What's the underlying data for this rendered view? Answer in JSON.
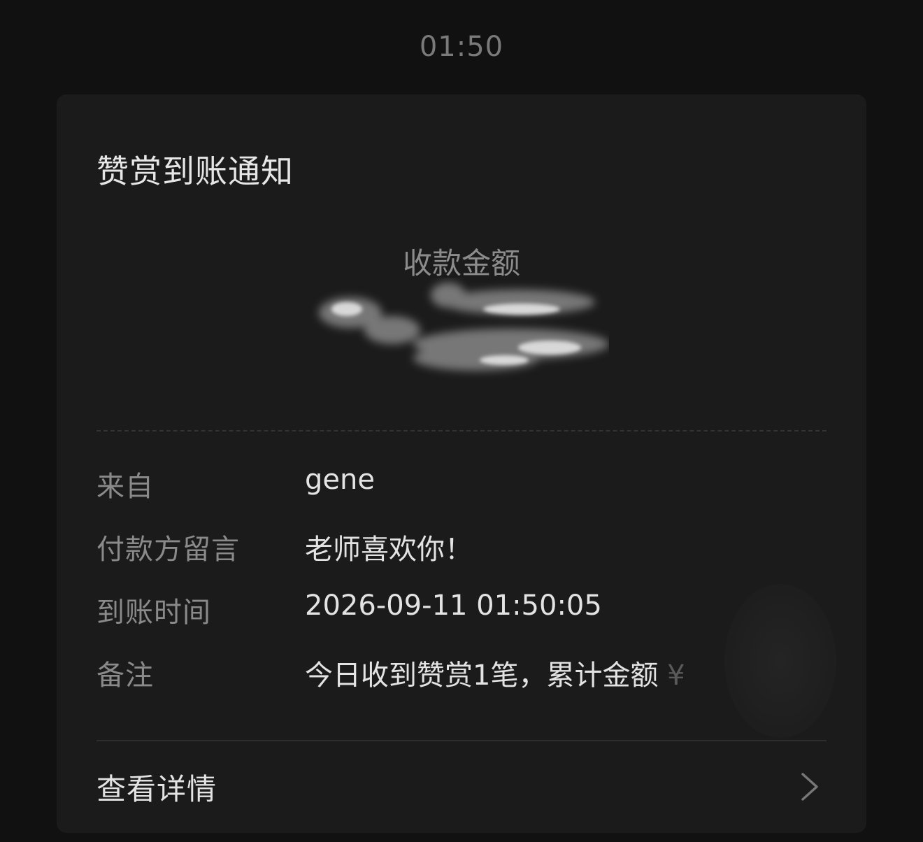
{
  "timestamp": "01:50",
  "card": {
    "title": "赞赏到账通知",
    "amount_label": "收款金额",
    "rows": [
      {
        "key": "来自",
        "value": "gene"
      },
      {
        "key": "付款方留言",
        "value": "老师喜欢你！"
      },
      {
        "key": "到账时间",
        "value": "2026-09-11 01:50:05"
      },
      {
        "key": "备注",
        "value": "今日收到赞赏1笔，累计金额",
        "suffix": "¥"
      }
    ],
    "details_label": "查看详情",
    "icons": {
      "amount": "redacted-scribble",
      "details": "chevron-right-icon"
    }
  }
}
